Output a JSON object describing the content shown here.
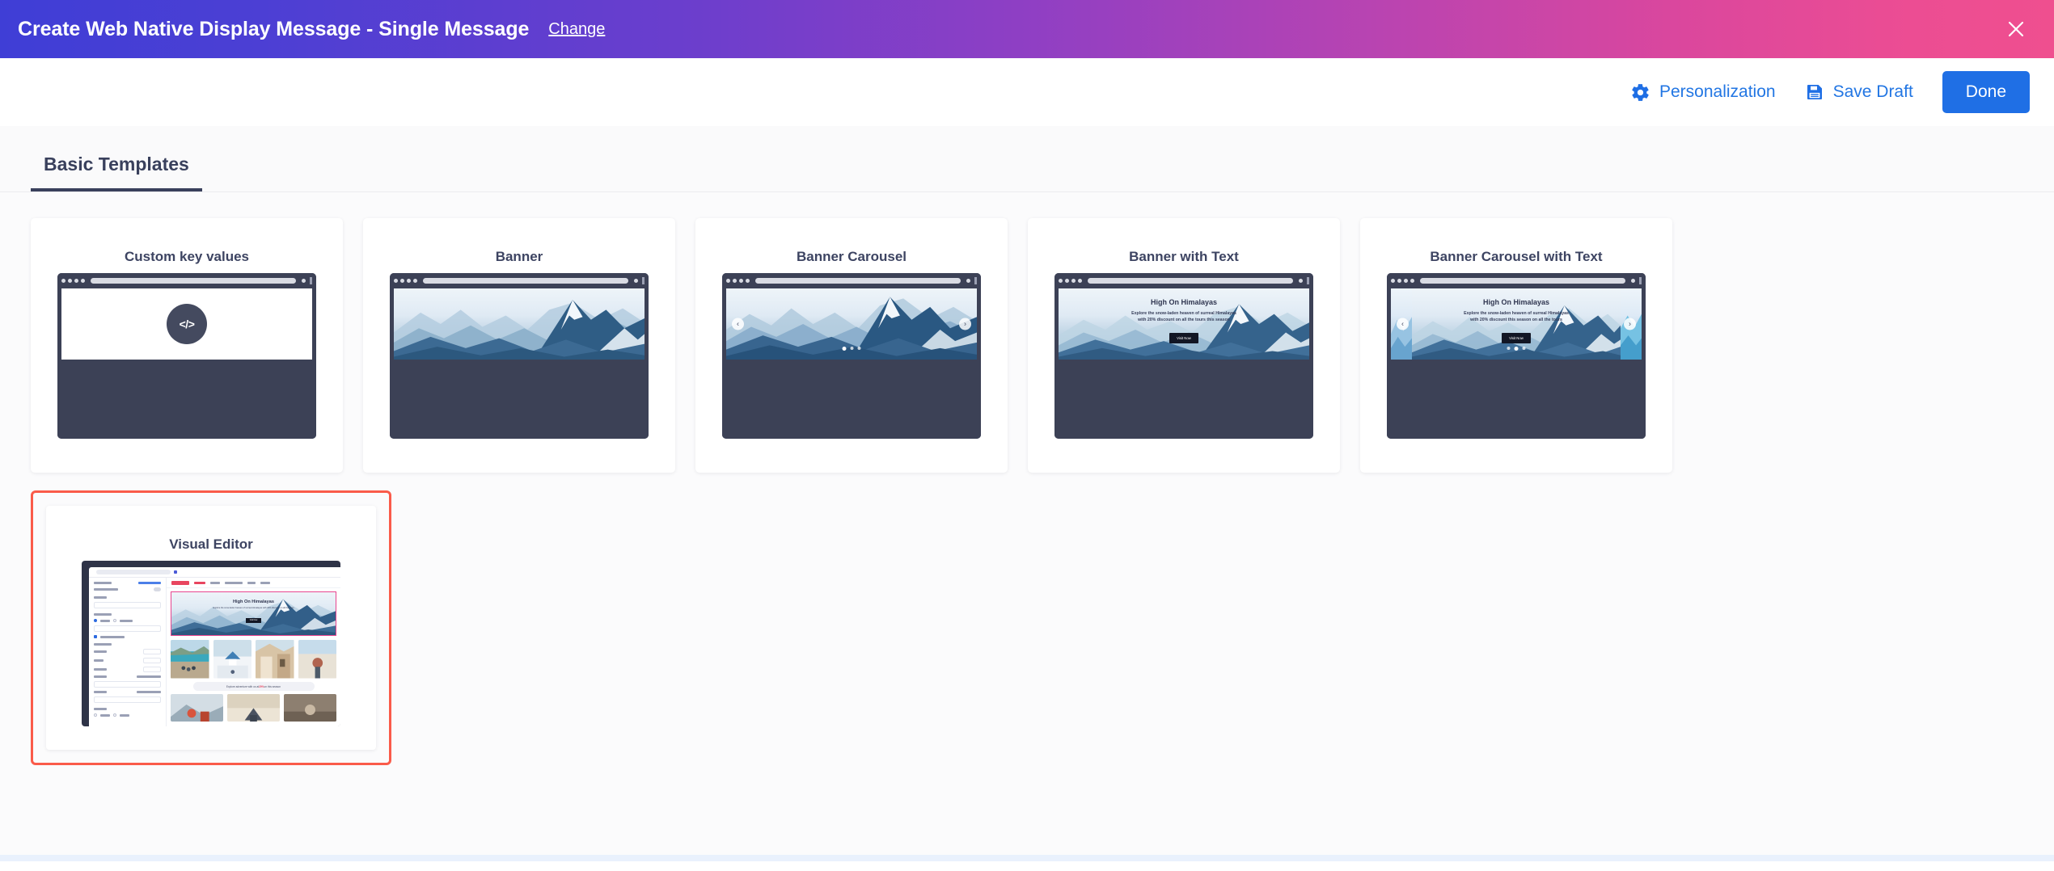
{
  "titlebar": {
    "title": "Create Web Native Display Message - Single Message",
    "change_label": "Change",
    "close_icon": "close-icon",
    "gradient_start": "#3f3ed6",
    "gradient_end": "#ef4f8f"
  },
  "toolbar": {
    "personalization_label": "Personalization",
    "personalization_icon": "gear-icon",
    "save_draft_label": "Save Draft",
    "save_draft_icon": "floppy-disk-icon",
    "done_label": "Done",
    "accent_color": "#1f6fe5"
  },
  "tabs": [
    {
      "label": "Basic Templates",
      "active": true
    }
  ],
  "selection_color": "#fa5b4a",
  "templates": [
    {
      "title": "Custom key values",
      "kind": "code",
      "code_glyph": "</>",
      "selected": false
    },
    {
      "title": "Banner",
      "kind": "banner",
      "selected": false
    },
    {
      "title": "Banner Carousel",
      "kind": "carousel",
      "selected": false,
      "dots": 3,
      "active_dot": 1,
      "prev_icon": "chevron-left-icon",
      "next_icon": "chevron-right-icon"
    },
    {
      "title": "Banner with Text",
      "kind": "banner-text",
      "selected": false,
      "overlay": {
        "heading": "High On Himalayas",
        "body_line1": "Explore the snow-laden heaven of surreal Himalayas",
        "body_line2": "with 20% discount on all the tours this season",
        "cta": "Visit Now"
      }
    },
    {
      "title": "Banner Carousel with Text",
      "kind": "carousel-text",
      "selected": false,
      "dots": 3,
      "active_dot": 1,
      "prev_icon": "chevron-left-icon",
      "next_icon": "chevron-right-icon",
      "overlay": {
        "heading": "High On Himalayas",
        "body_line1": "Explore the snow-laden heaven of surreal Himalayas",
        "body_line2": "with 20% discount this season on all the tours",
        "cta": "Visit Now"
      }
    },
    {
      "title": "Visual Editor",
      "kind": "visual-editor",
      "selected": true,
      "editor": {
        "hero_heading": "High On Himalayas",
        "hero_body": "Explore the snow-laden heaven of surreal Himalayas with 20% discount on all the tours",
        "hero_cta": "Visit Now",
        "promo_prefix": "Explore adventure with us at ",
        "promo_highlight": "20%",
        "promo_suffix": " on this season"
      }
    }
  ]
}
